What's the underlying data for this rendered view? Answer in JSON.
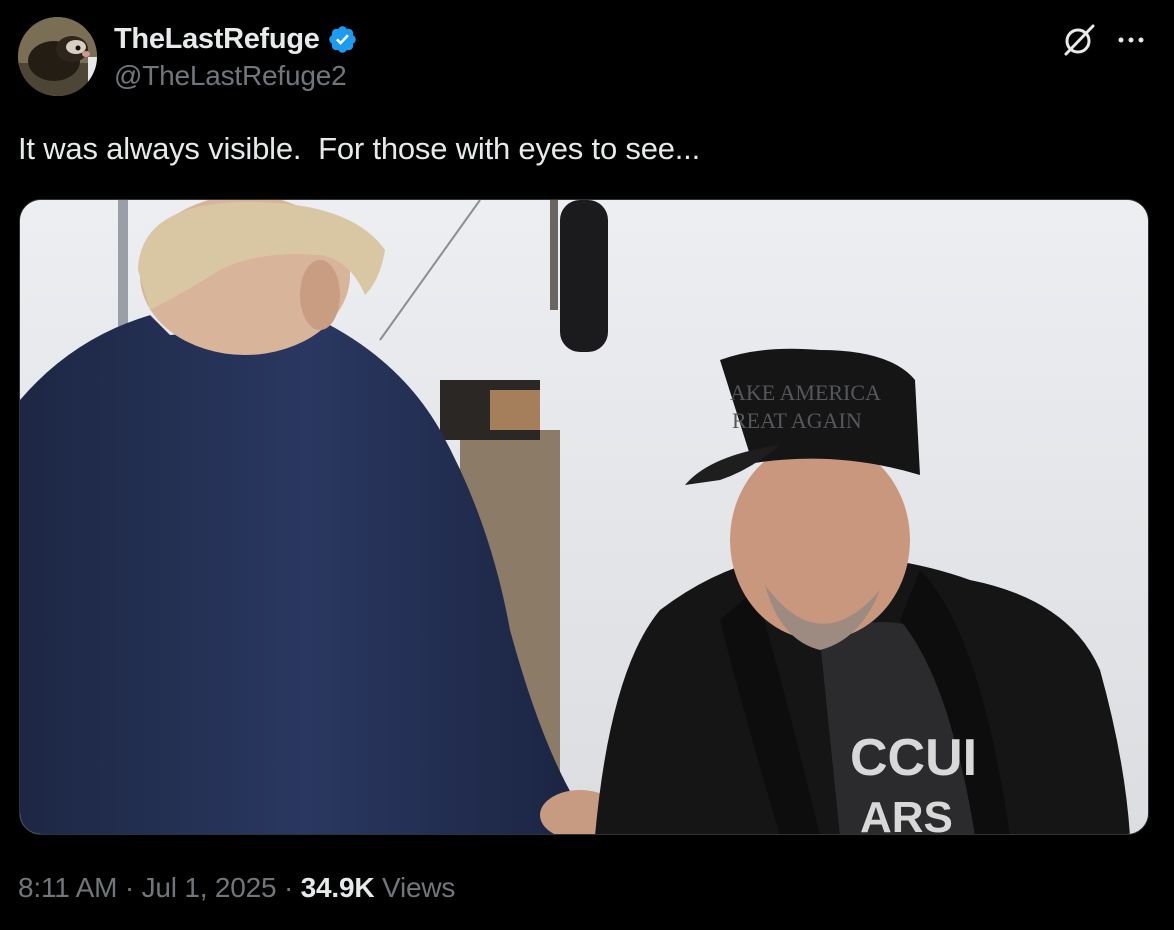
{
  "tweet": {
    "author": {
      "display_name": "TheLastRefuge",
      "handle": "@TheLastRefuge2",
      "verified": true,
      "verified_color": "#1d9bf0",
      "avatar_icon": "avatar-photo"
    },
    "text": "It was always visible.  For those with eyes to see...",
    "media": {
      "type": "photo",
      "cap_text_line1": "AKE AMERICA",
      "cap_text_line2": "REAT AGAIN",
      "shirt_text_line1": "CCUI",
      "shirt_text_line2": "ARS"
    },
    "meta": {
      "time": "8:11 AM",
      "separator": " · ",
      "date": "Jul 1, 2025",
      "views_count": "34.9K",
      "views_label": "Views"
    }
  },
  "icons": {
    "grok": "grok-icon",
    "more": "more-options-icon",
    "verified": "verified-badge-icon"
  },
  "colors": {
    "background": "#000000",
    "primary_text": "#e7e9ea",
    "secondary_text": "#71767b",
    "accent": "#1d9bf0"
  }
}
